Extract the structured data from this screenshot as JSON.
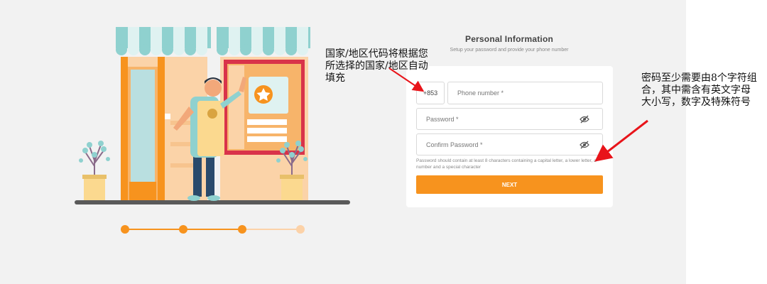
{
  "form": {
    "title": "Personal Information",
    "subtitle": "Setup your password and provide your phone number",
    "country_code": "+853",
    "phone_placeholder": "Phone number *",
    "password_placeholder": "Password *",
    "confirm_password_placeholder": "Confirm Password *",
    "password_hint": "Password should contain at least 8 characters containing a capital letter, a lower letter, a number and a special character",
    "next_label": "NEXT"
  },
  "annotations": {
    "country_code_note": "国家/地区代码将根据您所选择的国家/地区自动填充",
    "password_note": "密码至少需要由8个字符组合，其中需含有英文字母大小写，数字及特殊符号"
  },
  "stepper": {
    "steps_total": 4,
    "current_step": 3
  },
  "colors": {
    "accent": "#f7931e",
    "accent_light": "#fcd2a8",
    "arrow": "#e8141a",
    "awning": "#8fd1cf",
    "background": "#f2f2f2"
  },
  "icons": {
    "password_toggle": "eye-off-icon",
    "badge": "star-icon"
  }
}
